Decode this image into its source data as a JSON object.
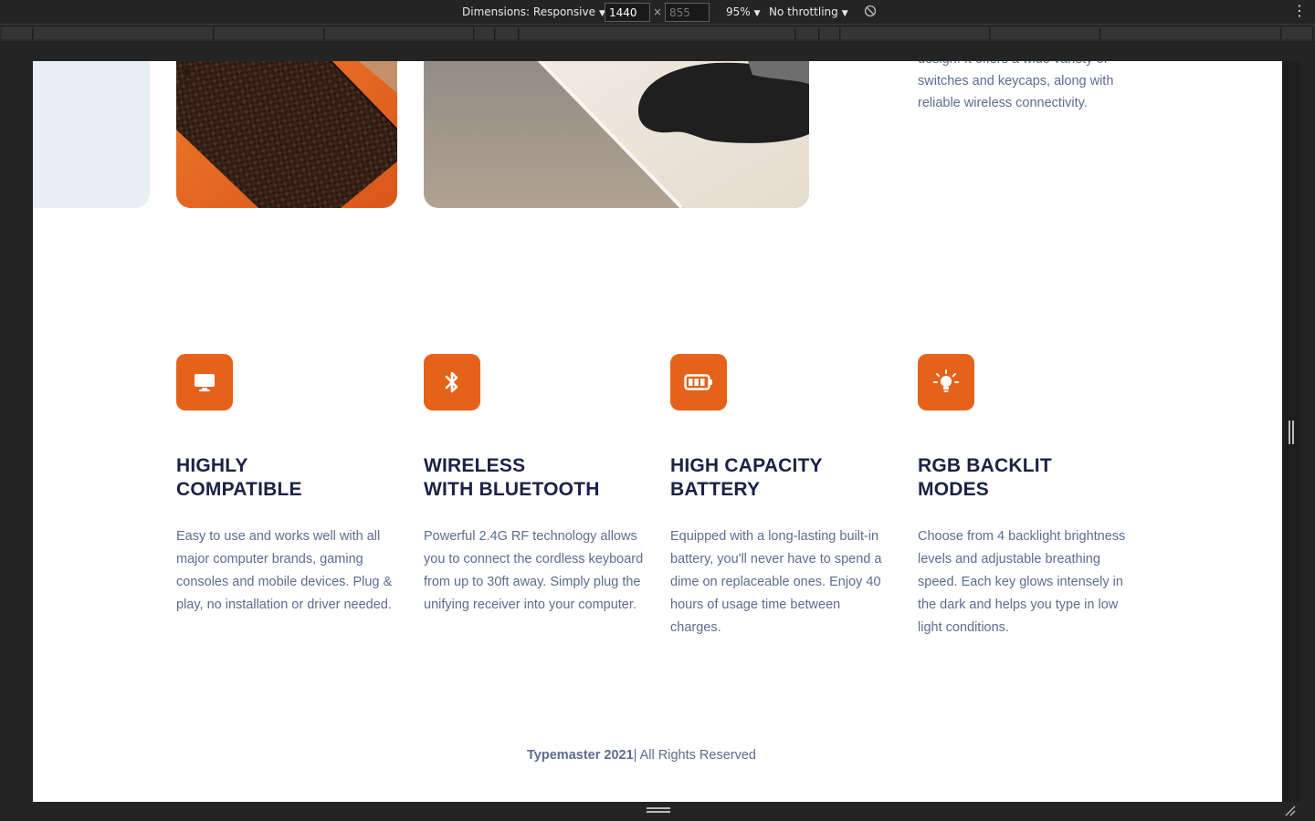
{
  "devtools": {
    "dimensions_label": "Dimensions: Responsive",
    "width_value": "1440",
    "height_placeholder": "855",
    "times_symbol": "×",
    "zoom": "95%",
    "throttling": "No throttling",
    "caret": "▼",
    "menu_glyph": "⋮"
  },
  "intro": {
    "text": "design. It offers a wide variety of switches and keycaps, along with reliable wireless connectivity."
  },
  "features": [
    {
      "title": "Highly\nCompatible",
      "icon": "monitor-icon",
      "description": "Easy to use and works well with all major computer brands, gaming consoles and mobile devices. Plug & play, no installation or driver needed."
    },
    {
      "title": "Wireless\nwith Bluetooth",
      "icon": "bluetooth-icon",
      "description": "Powerful 2.4G RF technology allows you to connect the cordless keyboard from up to 30ft away. Simply plug the unifying receiver into your computer."
    },
    {
      "title": "High Capacity\nBattery",
      "icon": "battery-icon",
      "description": "Equipped with a long-lasting built-in battery, you'll never have to spend a dime on replaceable ones. Enjoy 40 hours of usage time between charges."
    },
    {
      "title": "RGB Backlit\nModes",
      "icon": "lightbulb-icon",
      "description": "Choose from 4 backlight brightness levels and adjustable breathing speed. Each key glows intensely in the dark and helps you type in low light conditions."
    }
  ],
  "footer": {
    "brand": "Typemaster 2021",
    "rest": "| All Rights Reserved"
  },
  "colors": {
    "accent": "#e5621b",
    "heading": "#1a2245",
    "body_text": "#5d6c91",
    "light_card": "#e7eff3"
  }
}
